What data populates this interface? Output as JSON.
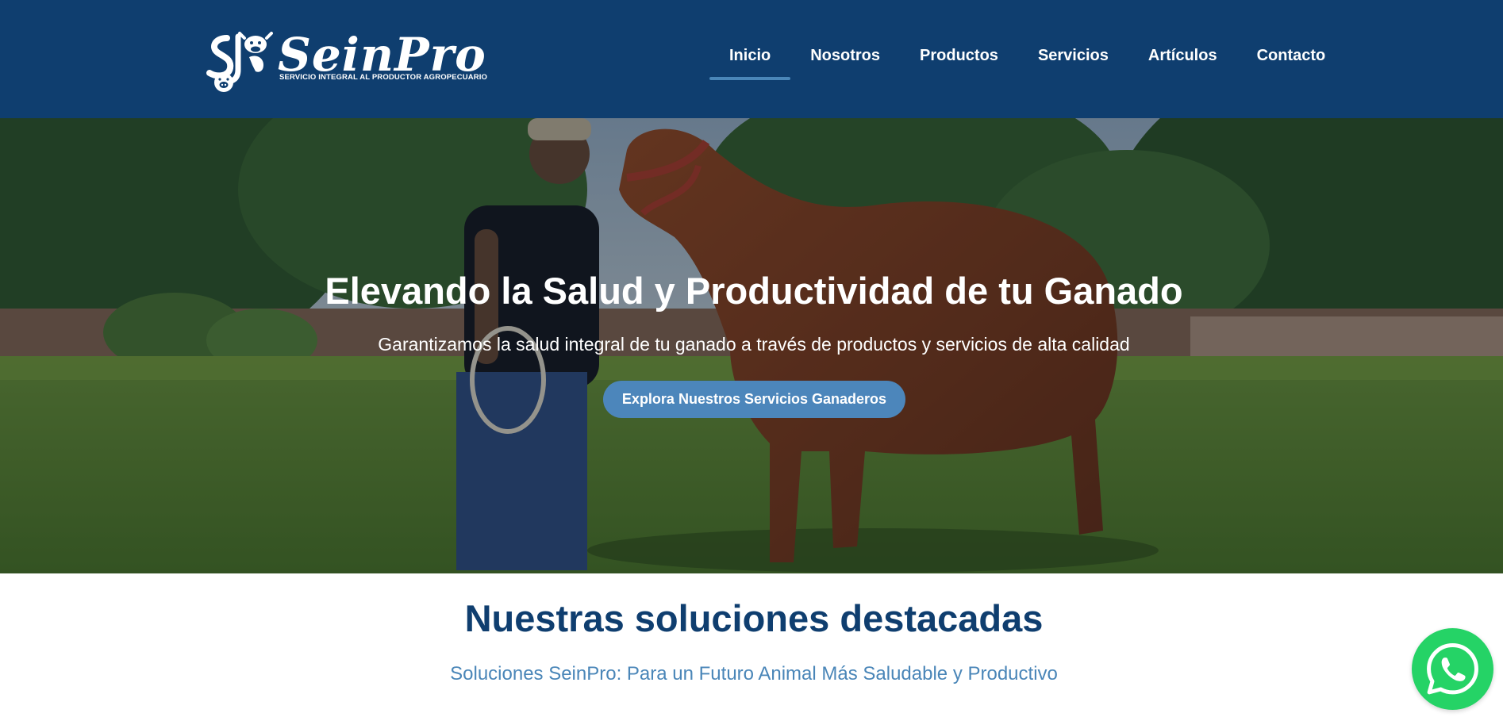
{
  "brand": {
    "name": "SeinPro",
    "tagline": "SERVICIO INTEGRAL AL PRODUCTOR AGROPECUARIO",
    "colors": {
      "header": "#0f3e6f",
      "accent": "#4a86b8",
      "whatsapp": "#25d366"
    }
  },
  "nav": {
    "items": [
      {
        "label": "Inicio",
        "active": true
      },
      {
        "label": "Nosotros",
        "active": false
      },
      {
        "label": "Productos",
        "active": false
      },
      {
        "label": "Servicios",
        "active": false
      },
      {
        "label": "Artículos",
        "active": false
      },
      {
        "label": "Contacto",
        "active": false
      }
    ]
  },
  "hero": {
    "title": "Elevando la Salud y Productividad de tu Ganado",
    "subtitle": "Garantizamos la salud integral de tu ganado a través de productos y servicios de alta calidad",
    "cta_label": "Explora Nuestros Servicios Ganaderos",
    "image_subject": "man-with-horse-photo"
  },
  "featured": {
    "title": "Nuestras soluciones destacadas",
    "subtitle": "Soluciones SeinPro: Para un Futuro Animal Más Saludable y Productivo"
  },
  "floating": {
    "whatsapp_icon": "whatsapp-icon"
  }
}
